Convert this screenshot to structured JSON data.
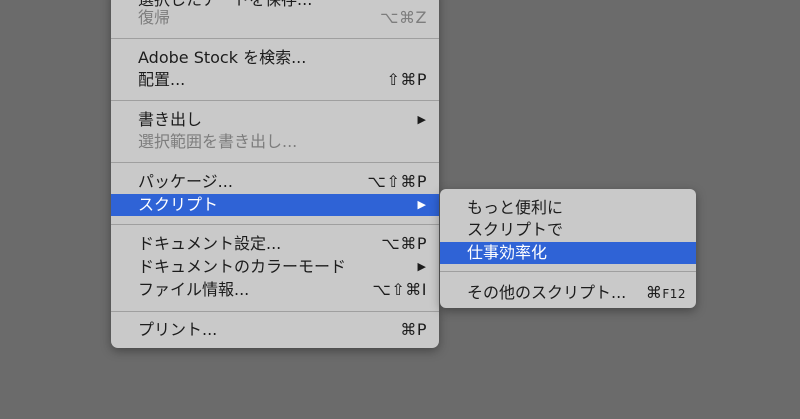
{
  "main_menu": {
    "items": [
      {
        "label": "選択したアートを保存...",
        "shortcut": ""
      },
      {
        "label": "復帰",
        "shortcut": "⌥⌘Z"
      },
      {
        "label": "Adobe Stock を検索...",
        "shortcut": ""
      },
      {
        "label": "配置...",
        "shortcut": "⇧⌘P"
      },
      {
        "label": "書き出し",
        "arrow": "▶"
      },
      {
        "label": "選択範囲を書き出し..."
      },
      {
        "label": "パッケージ...",
        "shortcut": "⌥⇧⌘P"
      },
      {
        "label": "スクリプト",
        "arrow": "▶"
      },
      {
        "label": "ドキュメント設定...",
        "shortcut": "⌥⌘P"
      },
      {
        "label": "ドキュメントのカラーモード",
        "arrow": "▶"
      },
      {
        "label": "ファイル情報...",
        "shortcut": "⌥⇧⌘I"
      },
      {
        "label": "プリント...",
        "shortcut": "⌘P"
      }
    ]
  },
  "submenu": {
    "items": [
      {
        "label": "もっと便利に"
      },
      {
        "label": "スクリプトで"
      },
      {
        "label": "仕事効率化"
      },
      {
        "label": "その他のスクリプト...",
        "shortcut_symbol": "⌘",
        "shortcut_key": "F12"
      }
    ]
  },
  "colors": {
    "background": "#6b6b6b",
    "menu": "#c9c9c9",
    "highlight": "#2f63d6"
  }
}
